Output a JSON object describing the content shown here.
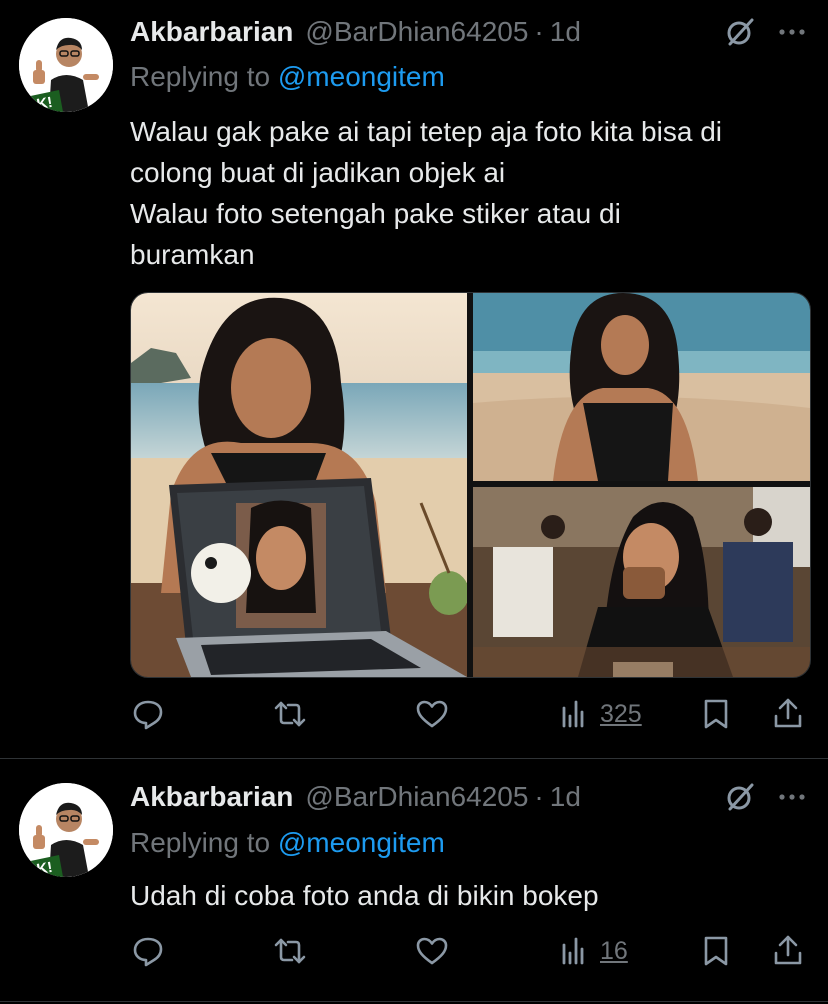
{
  "tweets": [
    {
      "author_name": "Akbarbarian",
      "handle": "@BarDhian64205",
      "separator": "·",
      "time": "1d",
      "replying_prefix": "Replying to ",
      "replying_mention": "@meongitem",
      "lines": [
        "Walau gak pake ai tapi tetep aja foto kita bisa di",
        "colong buat di jadikan objek ai",
        "Walau foto setengah pake stiker atau di",
        "buramkan"
      ],
      "views": "325"
    },
    {
      "author_name": "Akbarbarian",
      "handle": "@BarDhian64205",
      "separator": "·",
      "time": "1d",
      "replying_prefix": "Replying to ",
      "replying_mention": "@meongitem",
      "lines": [
        "Udah di coba foto anda di bikin bokep"
      ],
      "views": "16"
    }
  ],
  "avatar_badge_text": "OK!",
  "icons": {
    "grok": "grok-slash-icon",
    "more": "more-dots-icon",
    "reply": "reply-bubble-icon",
    "retweet": "retweet-icon",
    "like": "heart-icon",
    "views": "views-bar-icon",
    "bookmark": "bookmark-icon",
    "share": "share-upload-icon"
  },
  "colors": {
    "background": "#000000",
    "text": "#e7e9ea",
    "muted": "#71767b",
    "link": "#1d9bf0",
    "divider": "#2f3336"
  }
}
